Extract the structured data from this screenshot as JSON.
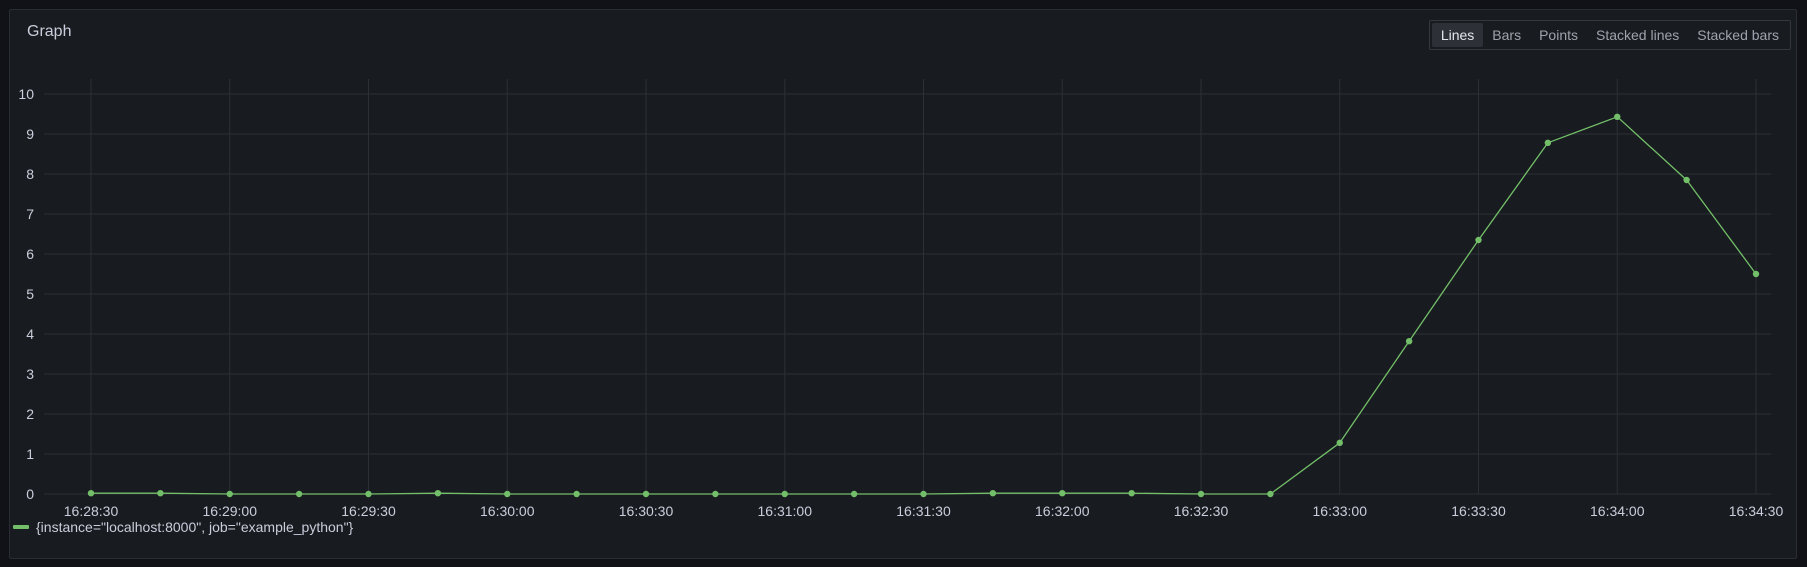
{
  "panel": {
    "title": "Graph"
  },
  "toggle": {
    "options": [
      "Lines",
      "Bars",
      "Points",
      "Stacked lines",
      "Stacked bars"
    ],
    "selected": "Lines"
  },
  "colors": {
    "series": "#73bf69",
    "grid": "#2c2f35",
    "axis_text": "#ccccdc"
  },
  "legend": {
    "label": "{instance=\"localhost:8000\", job=\"example_python\"}"
  },
  "chart_data": {
    "type": "line",
    "title": "Graph",
    "xlabel": "",
    "ylabel": "",
    "ylim": [
      0,
      10
    ],
    "y_ticks": [
      "0",
      "1",
      "2",
      "3",
      "4",
      "5",
      "6",
      "7",
      "8",
      "9",
      "10"
    ],
    "x_ticks": [
      "16:28:30",
      "16:29:00",
      "16:29:30",
      "16:30:00",
      "16:30:30",
      "16:31:00",
      "16:31:30",
      "16:32:00",
      "16:32:30",
      "16:33:00",
      "16:33:30",
      "16:34:00",
      "16:34:30"
    ],
    "x_range": [
      "16:28:30",
      "16:34:30"
    ],
    "grid": true,
    "legend_position": "bottom-left",
    "series": [
      {
        "name": "{instance=\"localhost:8000\", job=\"example_python\"}",
        "x": [
          "16:28:30",
          "16:28:45",
          "16:29:00",
          "16:29:15",
          "16:29:30",
          "16:29:45",
          "16:30:00",
          "16:30:15",
          "16:30:30",
          "16:30:45",
          "16:31:00",
          "16:31:15",
          "16:31:30",
          "16:31:45",
          "16:32:00",
          "16:32:15",
          "16:32:30",
          "16:32:45",
          "16:33:00",
          "16:33:15",
          "16:33:30",
          "16:33:45",
          "16:34:00",
          "16:34:15",
          "16:34:30"
        ],
        "values": [
          0.02,
          0.02,
          0.0,
          0.0,
          0.0,
          0.02,
          0.0,
          0.0,
          0.0,
          0.0,
          0.0,
          0.0,
          0.0,
          0.02,
          0.02,
          0.02,
          0.0,
          0.0,
          1.28,
          3.82,
          6.35,
          8.78,
          9.43,
          7.85,
          5.5
        ]
      }
    ]
  }
}
